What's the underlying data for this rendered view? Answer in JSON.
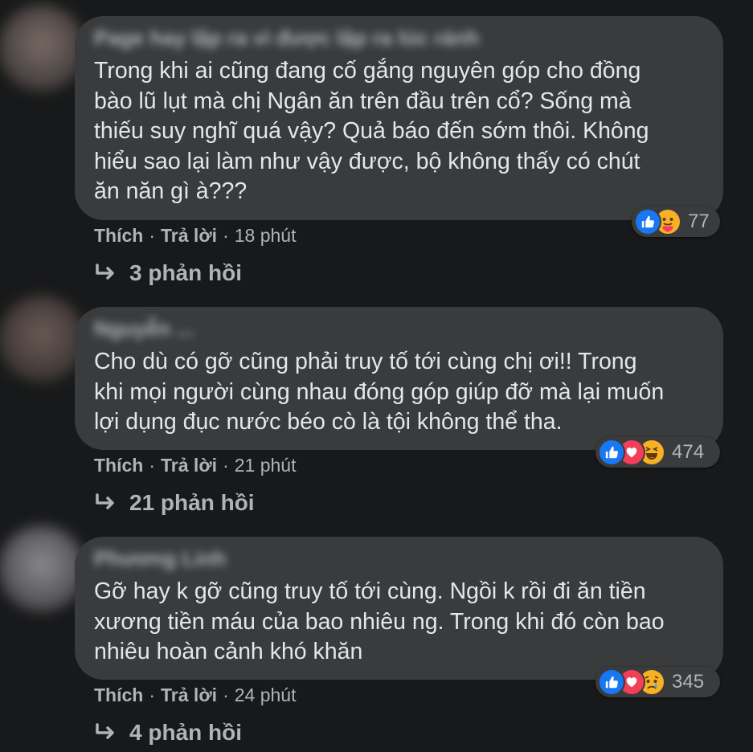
{
  "colors": {
    "background": "#18191a",
    "bubble": "#3a3b3c",
    "text": "#e4e6eb",
    "secondary_text": "#b0b3b8",
    "like_blue": "#1877f2",
    "love_red": "#f33e58",
    "emoji_yellow": "#f7b125"
  },
  "comments": [
    {
      "author": "Page hay lập ra vì được lập ra lúc rảnh",
      "text": "Trong khi ai cũng đang cố gắng nguyên góp cho đồng\nbào lũ lụt mà chị Ngân ăn trên đầu trên cổ? Sống mà\nthiếu suy nghĩ quá vậy? Quả báo đến sớm thôi. Không\nhiểu sao lại làm như vậy được, bộ không thấy có chút\năn năn gì à???",
      "like_label": "Thích",
      "reply_label": "Trả lời",
      "time": "18 phút",
      "reaction_icons": [
        "like-icon",
        "care-icon"
      ],
      "reaction_count": "77",
      "replies_label": "3 phản hồi"
    },
    {
      "author": "Nguyễn ...",
      "text": "Cho dù có gỡ cũng phải truy tố tới cùng chị ơi!! Trong\nkhi mọi người cùng nhau đóng góp giúp đỡ mà lại muốn\nlợi dụng đục nước béo cò là tội không thể tha.",
      "like_label": "Thích",
      "reply_label": "Trả lời",
      "time": "21 phút",
      "reaction_icons": [
        "like-icon",
        "love-icon",
        "haha-icon"
      ],
      "reaction_count": "474",
      "replies_label": "21 phản hồi"
    },
    {
      "author": "Phương Linh",
      "text": "Gỡ hay k gỡ cũng truy tố tới cùng. Ngồi k rồi đi ăn tiền\nxương tiền máu của bao nhiêu ng. Trong khi đó còn bao\nnhiêu hoàn cảnh khó khăn",
      "like_label": "Thích",
      "reply_label": "Trả lời",
      "time": "24 phút",
      "reaction_icons": [
        "like-icon",
        "love-icon",
        "sad-icon"
      ],
      "reaction_count": "345",
      "replies_label": "4 phản hồi"
    }
  ]
}
